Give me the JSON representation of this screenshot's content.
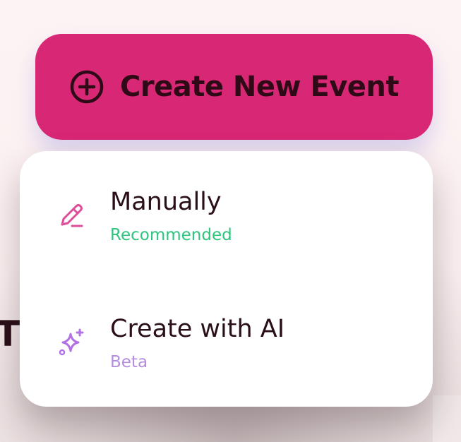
{
  "create_button": {
    "label": "Create New Event",
    "icon": "plus-circle-icon"
  },
  "menu": {
    "items": [
      {
        "title": "Manually",
        "subtitle": "Recommended",
        "icon": "pencil-icon",
        "icon_color": "#de4d97",
        "subtitle_color": "#2ec47e"
      },
      {
        "title": "Create with AI",
        "subtitle": "Beta",
        "icon": "sparkles-icon",
        "icon_color": "#b272e6",
        "subtitle_color": "#b58de0"
      }
    ]
  },
  "background": {
    "partial_heading": "T"
  },
  "colors": {
    "button_bg": "#d82774",
    "button_text": "#2e0a17",
    "card_bg": "#ffffff",
    "title_text": "#2a0f18"
  }
}
